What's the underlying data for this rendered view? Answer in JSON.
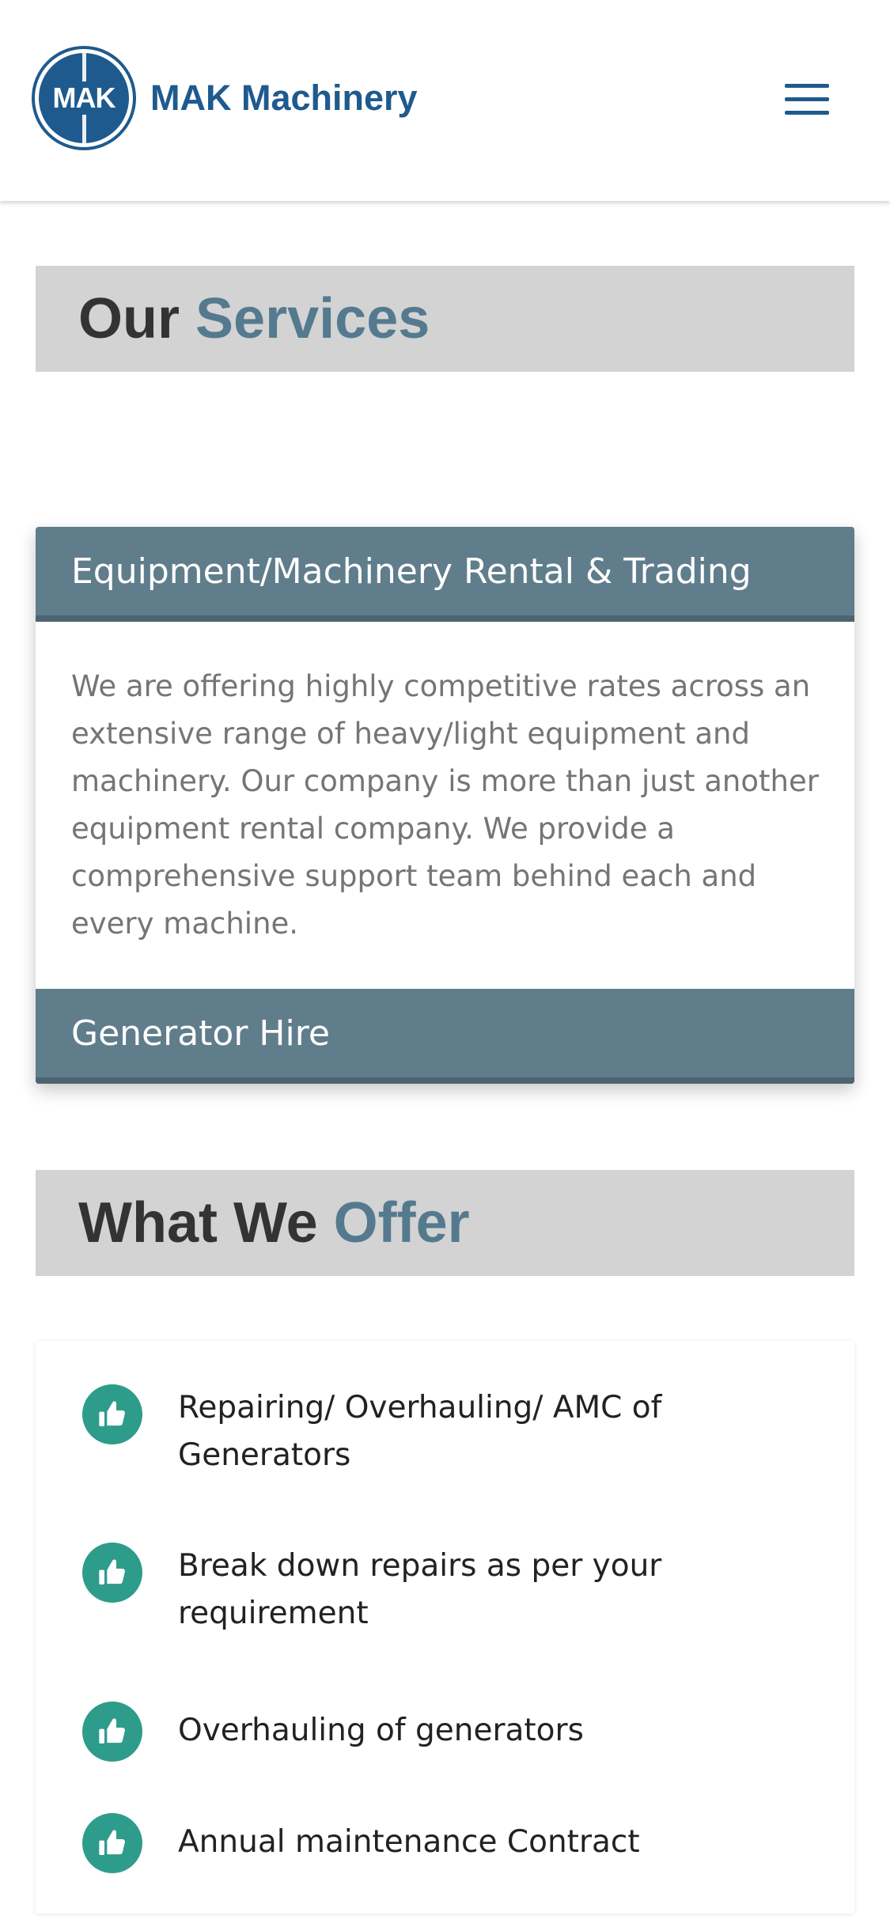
{
  "header": {
    "logo_mark": "MAK",
    "brand_name": "MAK Machinery",
    "menu_icon": "hamburger-menu-icon"
  },
  "services": {
    "title_dark": "Our",
    "title_accent": "Services",
    "items": [
      {
        "label": "Equipment/Machinery Rental & Trading",
        "expanded": true,
        "body": "We are offering highly competitive rates across an extensive range of heavy/light equipment and machinery. Our company is more than just another equipment rental company. We provide a comprehensive support team behind each and every machine."
      },
      {
        "label": "Generator Hire",
        "expanded": false
      }
    ]
  },
  "offer": {
    "title_dark": "What We",
    "title_accent": "Offer",
    "icon": "thumbs-up-icon",
    "items": [
      "Repairing/ Overhauling/ AMC of Generators",
      "Break down repairs as per your requirement",
      "Overhauling of generators",
      "Annual maintenance Contract"
    ]
  },
  "colors": {
    "brand_blue": "#1e5a8e",
    "accordion_header": "#607d8b",
    "heading_band": "#d3d3d3",
    "heading_accent": "#557a8f",
    "icon_green": "#2e9c8a"
  }
}
